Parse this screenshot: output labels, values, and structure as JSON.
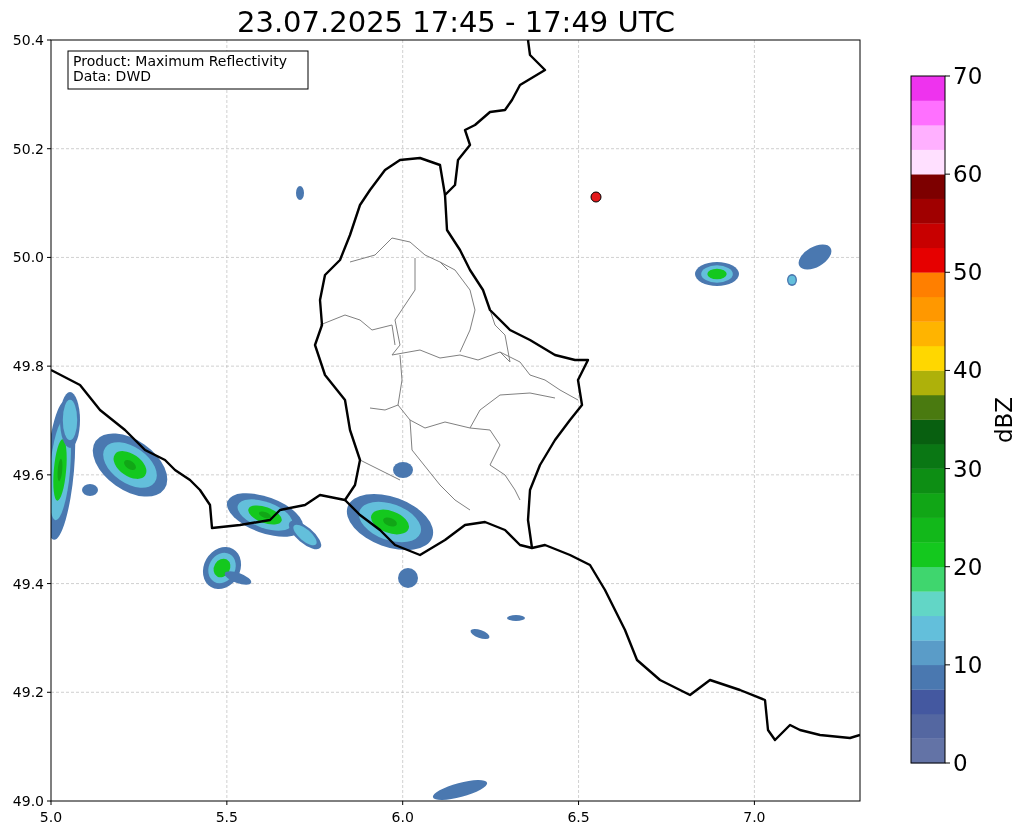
{
  "title": "23.07.2025 17:45 - 17:49 UTC",
  "info_box": [
    "Product: Maximum Reflectivity",
    "Data: DWD"
  ],
  "map": {
    "x_ticks": [
      "5.0",
      "5.5",
      "6.0",
      "6.5",
      "7.0"
    ],
    "y_ticks": [
      "50.4",
      "50.2",
      "50.0",
      "49.8",
      "49.6",
      "49.4",
      "49.2",
      "49.0"
    ]
  },
  "colorbar": {
    "label": "dBZ",
    "ticks": [
      "70",
      "60",
      "50",
      "40",
      "30",
      "20",
      "10",
      "0"
    ],
    "segments": [
      {
        "color": "#6373a6"
      },
      {
        "color": "#5467a1"
      },
      {
        "color": "#4458a0"
      },
      {
        "color": "#4a78b0"
      },
      {
        "color": "#5a9cc8"
      },
      {
        "color": "#63bfdb"
      },
      {
        "color": "#62d6c6"
      },
      {
        "color": "#3fd66e"
      },
      {
        "color": "#14c81e"
      },
      {
        "color": "#12b81a"
      },
      {
        "color": "#11a616"
      },
      {
        "color": "#0d8e14"
      },
      {
        "color": "#0a7714"
      },
      {
        "color": "#085f10"
      },
      {
        "color": "#4a7a10"
      },
      {
        "color": "#aeb10a"
      },
      {
        "color": "#ffd700"
      },
      {
        "color": "#ffb400"
      },
      {
        "color": "#ff9800"
      },
      {
        "color": "#ff7f00"
      },
      {
        "color": "#e60000"
      },
      {
        "color": "#c80000"
      },
      {
        "color": "#a00000"
      },
      {
        "color": "#7d0000"
      },
      {
        "color": "#ffe0ff"
      },
      {
        "color": "#ffb0ff"
      },
      {
        "color": "#ff70ff"
      },
      {
        "color": "#ee33ee"
      }
    ]
  }
}
